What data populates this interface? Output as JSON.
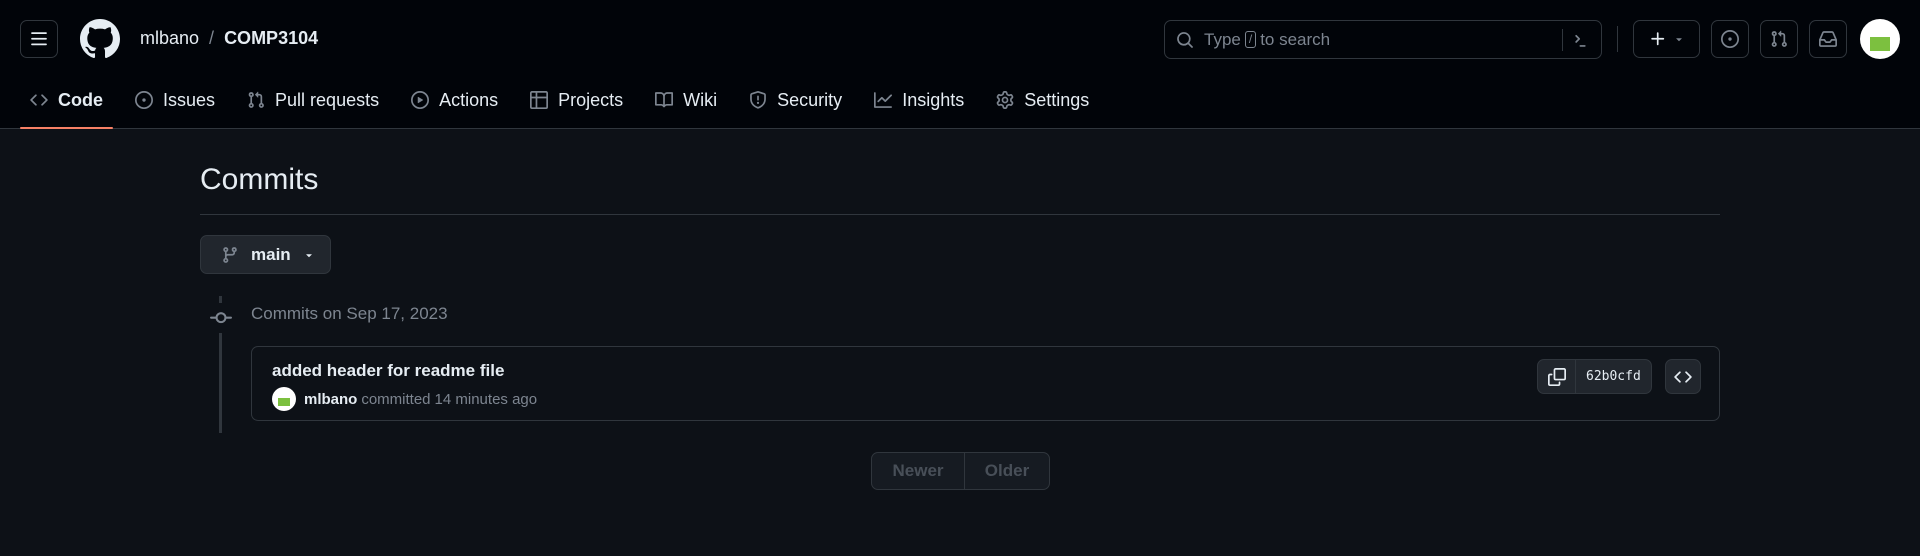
{
  "header": {
    "owner": "mlbano",
    "separator": "/",
    "repo": "COMP3104",
    "search": {
      "prefix": "Type",
      "key": "/",
      "suffix": "to search"
    }
  },
  "tabs": [
    {
      "label": "Code",
      "icon": "code-icon",
      "selected": true
    },
    {
      "label": "Issues",
      "icon": "issue-opened-icon"
    },
    {
      "label": "Pull requests",
      "icon": "git-pull-request-icon"
    },
    {
      "label": "Actions",
      "icon": "play-icon"
    },
    {
      "label": "Projects",
      "icon": "table-icon"
    },
    {
      "label": "Wiki",
      "icon": "book-icon"
    },
    {
      "label": "Security",
      "icon": "shield-icon"
    },
    {
      "label": "Insights",
      "icon": "graph-icon"
    },
    {
      "label": "Settings",
      "icon": "gear-icon"
    }
  ],
  "main": {
    "title": "Commits",
    "branch": "main",
    "group_label": "Commits on Sep 17, 2023",
    "commit": {
      "message": "added header for readme file",
      "author": "mlbano",
      "action": "committed",
      "time": "14 minutes ago",
      "sha": "62b0cfd"
    },
    "pager": {
      "newer": "Newer",
      "older": "Older"
    }
  },
  "colors": {
    "background": "#0d1117",
    "header_bg": "#010409",
    "border": "#30363d",
    "muted": "#7d8590",
    "tab_underline": "#f78166"
  }
}
